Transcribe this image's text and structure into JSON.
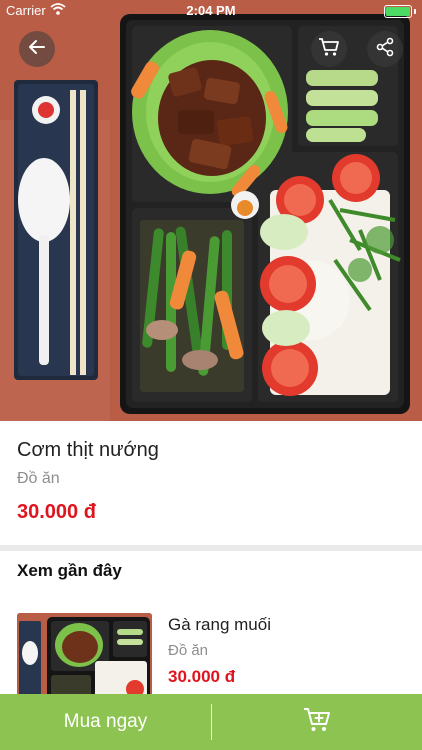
{
  "status_bar": {
    "carrier": "Carrier",
    "time": "2:04 PM",
    "battery_color": "#4cd964"
  },
  "hero": {
    "icons": [
      "back-arrow-icon",
      "cart-icon",
      "share-icon"
    ]
  },
  "product": {
    "title": "Cơm thịt nướng",
    "category": "Đồ ăn",
    "price": "30.000 đ"
  },
  "recent": {
    "heading": "Xem gần đây",
    "items": [
      {
        "name": "Gà rang muối",
        "category": "Đồ ăn",
        "price": "30.000 đ"
      }
    ]
  },
  "bottom_bar": {
    "buy_now_label": "Mua ngay",
    "add_to_cart_icon": "add-to-cart-icon"
  },
  "colors": {
    "accent": "#8dc350",
    "price": "#e0141e"
  }
}
